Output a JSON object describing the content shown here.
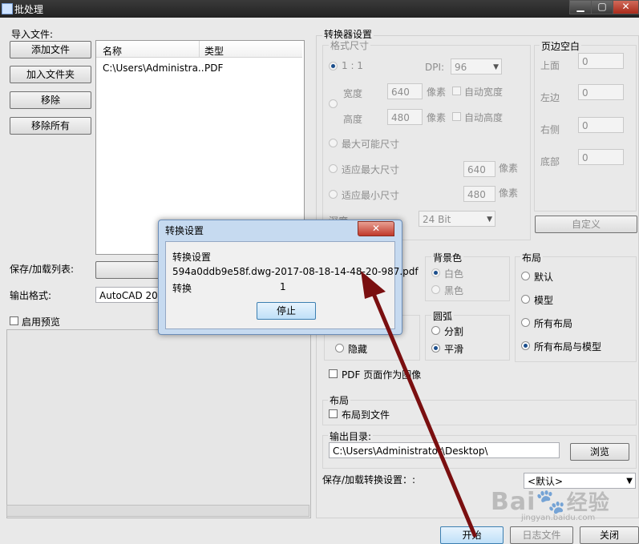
{
  "window": {
    "title": "批处理",
    "min_glyph": "▁",
    "max_glyph": "▢",
    "close_glyph": "✕"
  },
  "import": {
    "heading": "导入文件:",
    "buttons": {
      "add_file": "添加文件",
      "add_folder": "加入文件夹",
      "remove": "移除",
      "remove_all": "移除所有"
    },
    "columns": [
      "名称",
      "类型"
    ],
    "rows": [
      {
        "name": "C:\\Users\\Administra...",
        "type": "PDF"
      }
    ]
  },
  "save_load_list_label": "保存/加载列表:",
  "output_format_label": "输出格式:",
  "output_format_value": "AutoCAD 2000",
  "enable_preview_label": "启用预览",
  "converter": {
    "heading": "转换器设置",
    "format_size": {
      "heading": "格式尺寸",
      "ratio_label": "1 : 1",
      "dpi_label": "DPI:",
      "dpi_value": "96",
      "width_label": "宽度",
      "width_value": "640",
      "width_unit": "像素",
      "auto_width": "自动宽度",
      "height_label": "高度",
      "height_value": "480",
      "height_unit": "像素",
      "auto_height": "自动高度",
      "max_possible": "最大可能尺寸",
      "fit_max": "适应最大尺寸",
      "fit_max_value": "640",
      "fit_max_unit": "像素",
      "fit_min": "适应最小尺寸",
      "fit_min_value": "480",
      "fit_min_unit": "像素",
      "depth_label": "深度",
      "depth_value": "24 Bit"
    },
    "margins": {
      "heading": "页边空白",
      "top_label": "上面",
      "top_value": "0",
      "left_label": "左边",
      "left_value": "0",
      "right_label": "右侧",
      "right_value": "0",
      "bottom_label": "底部",
      "bottom_value": "0",
      "custom_button": "自定义"
    },
    "background": {
      "heading": "背景色",
      "white": "白色",
      "black": "黑色"
    },
    "layout": {
      "heading": "布局",
      "default": "默认",
      "model": "模型",
      "all_layouts": "所有布局",
      "all_layouts_model": "所有布局与模型"
    },
    "arc": {
      "heading": "圆弧",
      "split": "分割",
      "smooth": "平滑"
    },
    "hidden_label": "隐藏",
    "pdf_as_image": "PDF 页面作为图像",
    "layout2": {
      "heading": "布局",
      "layout_to_file": "布局到文件"
    },
    "output_dir": {
      "label": "输出目录:",
      "value": "C:\\Users\\Administrator\\Desktop\\",
      "browse": "浏览"
    },
    "save_load_settings_label": "保存/加载转换设置：:",
    "settings_value": "<默认>"
  },
  "footer": {
    "start": "开始",
    "log": "日志文件",
    "close": "关闭"
  },
  "dialog": {
    "title": "转换设置",
    "heading": "转换设置",
    "filename": "594a0ddb9e58f.dwg-2017-08-18-14-48-20-987.pdf",
    "convert_label": "转换",
    "convert_count": "1",
    "stop_button": "停止",
    "close_glyph": "✕"
  },
  "watermark": {
    "brand": "Bai",
    "brand_suffix": "经验",
    "url": "jingyan.baidu.com"
  },
  "colors": {
    "arrow": "#7a0f10",
    "dialog_frame": "#c6daf0",
    "close_red": "#c0392b"
  }
}
